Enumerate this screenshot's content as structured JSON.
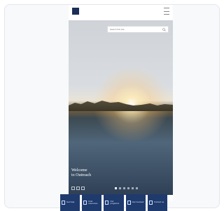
{
  "header": {
    "logo_name": "site-logo",
    "menu_icon": "hamburger-menu-icon"
  },
  "search": {
    "placeholder": "Search this site",
    "icon": "search-icon"
  },
  "hero": {
    "welcome_line_1": "Welcome",
    "welcome_line_2": "to Outreach",
    "carousel_slide_count": 6,
    "carousel_active_index": 0
  },
  "tiles": [
    {
      "icon": "globe-icon",
      "label": "Get help"
    },
    {
      "icon": "document-icon",
      "label": "Find resources"
    },
    {
      "icon": "calendar-icon",
      "label": "Our programs"
    },
    {
      "icon": "people-icon",
      "label": "Get involved"
    },
    {
      "icon": "contact-icon",
      "label": "Contact us"
    }
  ],
  "colors": {
    "brand_navy": "#1b2e57",
    "tile_blue": "#1f3a6d"
  }
}
